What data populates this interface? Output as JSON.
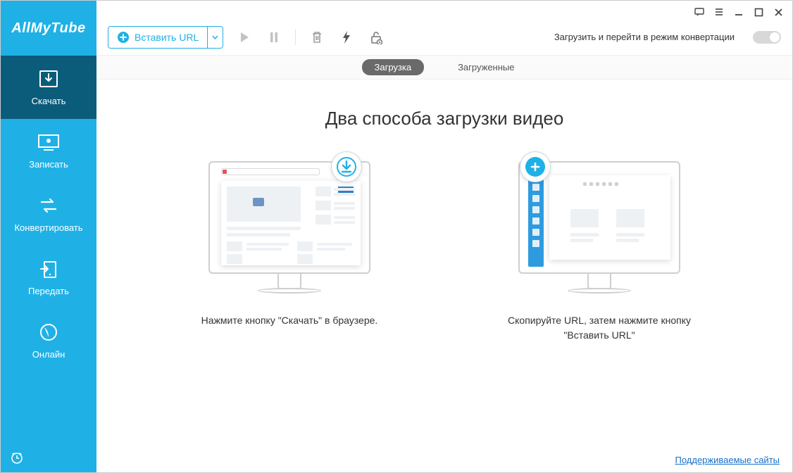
{
  "app": {
    "name": "AllMyTube"
  },
  "sidebar": {
    "items": [
      {
        "label": "Скачать"
      },
      {
        "label": "Записать"
      },
      {
        "label": "Конвертировать"
      },
      {
        "label": "Передать"
      },
      {
        "label": "Онлайн"
      }
    ]
  },
  "toolbar": {
    "paste_label": "Вставить URL",
    "convert_label": "Загрузить и перейти в режим конвертации"
  },
  "tabs": {
    "active": "Загрузка",
    "inactive": "Загруженные"
  },
  "content": {
    "headline": "Два способа загрузки видео",
    "method1_caption": "Нажмите кнопку \"Скачать\" в браузере.",
    "method2_caption": "Скопируйте URL, затем нажмите кнопку \"Вставить URL\""
  },
  "footer": {
    "link": "Поддерживаемые сайты"
  }
}
